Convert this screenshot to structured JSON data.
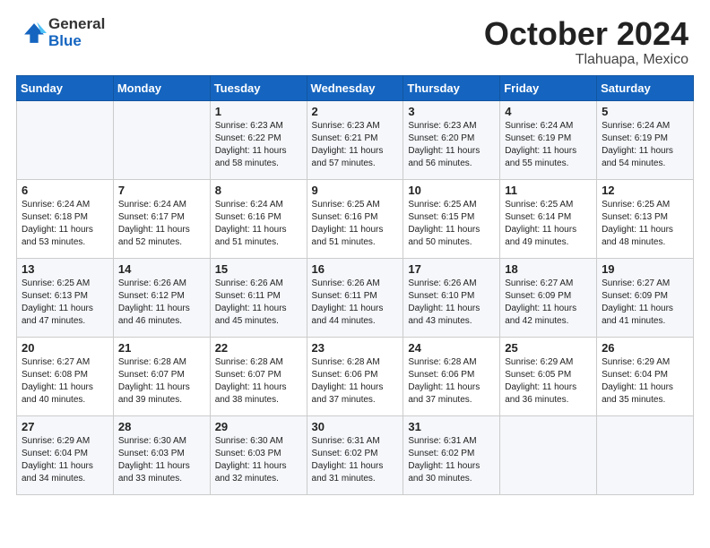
{
  "header": {
    "logo_general": "General",
    "logo_blue": "Blue",
    "month": "October 2024",
    "location": "Tlahuapa, Mexico"
  },
  "weekdays": [
    "Sunday",
    "Monday",
    "Tuesday",
    "Wednesday",
    "Thursday",
    "Friday",
    "Saturday"
  ],
  "weeks": [
    [
      {
        "day": "",
        "info": ""
      },
      {
        "day": "",
        "info": ""
      },
      {
        "day": "1",
        "info": "Sunrise: 6:23 AM\nSunset: 6:22 PM\nDaylight: 11 hours and 58 minutes."
      },
      {
        "day": "2",
        "info": "Sunrise: 6:23 AM\nSunset: 6:21 PM\nDaylight: 11 hours and 57 minutes."
      },
      {
        "day": "3",
        "info": "Sunrise: 6:23 AM\nSunset: 6:20 PM\nDaylight: 11 hours and 56 minutes."
      },
      {
        "day": "4",
        "info": "Sunrise: 6:24 AM\nSunset: 6:19 PM\nDaylight: 11 hours and 55 minutes."
      },
      {
        "day": "5",
        "info": "Sunrise: 6:24 AM\nSunset: 6:19 PM\nDaylight: 11 hours and 54 minutes."
      }
    ],
    [
      {
        "day": "6",
        "info": "Sunrise: 6:24 AM\nSunset: 6:18 PM\nDaylight: 11 hours and 53 minutes."
      },
      {
        "day": "7",
        "info": "Sunrise: 6:24 AM\nSunset: 6:17 PM\nDaylight: 11 hours and 52 minutes."
      },
      {
        "day": "8",
        "info": "Sunrise: 6:24 AM\nSunset: 6:16 PM\nDaylight: 11 hours and 51 minutes."
      },
      {
        "day": "9",
        "info": "Sunrise: 6:25 AM\nSunset: 6:16 PM\nDaylight: 11 hours and 51 minutes."
      },
      {
        "day": "10",
        "info": "Sunrise: 6:25 AM\nSunset: 6:15 PM\nDaylight: 11 hours and 50 minutes."
      },
      {
        "day": "11",
        "info": "Sunrise: 6:25 AM\nSunset: 6:14 PM\nDaylight: 11 hours and 49 minutes."
      },
      {
        "day": "12",
        "info": "Sunrise: 6:25 AM\nSunset: 6:13 PM\nDaylight: 11 hours and 48 minutes."
      }
    ],
    [
      {
        "day": "13",
        "info": "Sunrise: 6:25 AM\nSunset: 6:13 PM\nDaylight: 11 hours and 47 minutes."
      },
      {
        "day": "14",
        "info": "Sunrise: 6:26 AM\nSunset: 6:12 PM\nDaylight: 11 hours and 46 minutes."
      },
      {
        "day": "15",
        "info": "Sunrise: 6:26 AM\nSunset: 6:11 PM\nDaylight: 11 hours and 45 minutes."
      },
      {
        "day": "16",
        "info": "Sunrise: 6:26 AM\nSunset: 6:11 PM\nDaylight: 11 hours and 44 minutes."
      },
      {
        "day": "17",
        "info": "Sunrise: 6:26 AM\nSunset: 6:10 PM\nDaylight: 11 hours and 43 minutes."
      },
      {
        "day": "18",
        "info": "Sunrise: 6:27 AM\nSunset: 6:09 PM\nDaylight: 11 hours and 42 minutes."
      },
      {
        "day": "19",
        "info": "Sunrise: 6:27 AM\nSunset: 6:09 PM\nDaylight: 11 hours and 41 minutes."
      }
    ],
    [
      {
        "day": "20",
        "info": "Sunrise: 6:27 AM\nSunset: 6:08 PM\nDaylight: 11 hours and 40 minutes."
      },
      {
        "day": "21",
        "info": "Sunrise: 6:28 AM\nSunset: 6:07 PM\nDaylight: 11 hours and 39 minutes."
      },
      {
        "day": "22",
        "info": "Sunrise: 6:28 AM\nSunset: 6:07 PM\nDaylight: 11 hours and 38 minutes."
      },
      {
        "day": "23",
        "info": "Sunrise: 6:28 AM\nSunset: 6:06 PM\nDaylight: 11 hours and 37 minutes."
      },
      {
        "day": "24",
        "info": "Sunrise: 6:28 AM\nSunset: 6:06 PM\nDaylight: 11 hours and 37 minutes."
      },
      {
        "day": "25",
        "info": "Sunrise: 6:29 AM\nSunset: 6:05 PM\nDaylight: 11 hours and 36 minutes."
      },
      {
        "day": "26",
        "info": "Sunrise: 6:29 AM\nSunset: 6:04 PM\nDaylight: 11 hours and 35 minutes."
      }
    ],
    [
      {
        "day": "27",
        "info": "Sunrise: 6:29 AM\nSunset: 6:04 PM\nDaylight: 11 hours and 34 minutes."
      },
      {
        "day": "28",
        "info": "Sunrise: 6:30 AM\nSunset: 6:03 PM\nDaylight: 11 hours and 33 minutes."
      },
      {
        "day": "29",
        "info": "Sunrise: 6:30 AM\nSunset: 6:03 PM\nDaylight: 11 hours and 32 minutes."
      },
      {
        "day": "30",
        "info": "Sunrise: 6:31 AM\nSunset: 6:02 PM\nDaylight: 11 hours and 31 minutes."
      },
      {
        "day": "31",
        "info": "Sunrise: 6:31 AM\nSunset: 6:02 PM\nDaylight: 11 hours and 30 minutes."
      },
      {
        "day": "",
        "info": ""
      },
      {
        "day": "",
        "info": ""
      }
    ]
  ]
}
